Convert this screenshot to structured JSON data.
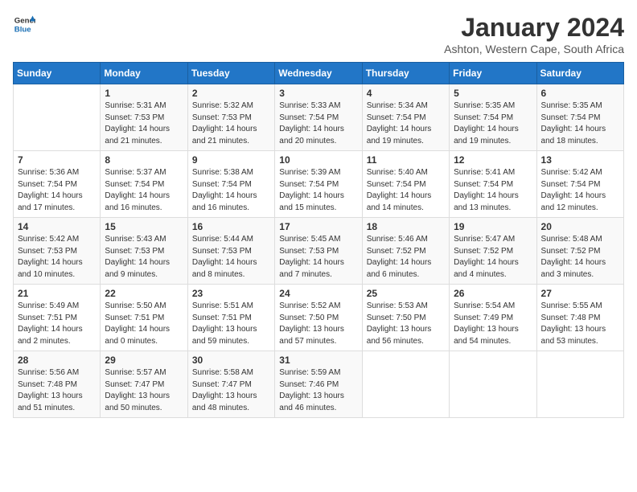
{
  "logo": {
    "line1": "General",
    "line2": "Blue"
  },
  "calendar": {
    "title": "January 2024",
    "subtitle": "Ashton, Western Cape, South Africa",
    "days_of_week": [
      "Sunday",
      "Monday",
      "Tuesday",
      "Wednesday",
      "Thursday",
      "Friday",
      "Saturday"
    ],
    "weeks": [
      [
        {
          "day": "",
          "info": ""
        },
        {
          "day": "1",
          "info": "Sunrise: 5:31 AM\nSunset: 7:53 PM\nDaylight: 14 hours\nand 21 minutes."
        },
        {
          "day": "2",
          "info": "Sunrise: 5:32 AM\nSunset: 7:53 PM\nDaylight: 14 hours\nand 21 minutes."
        },
        {
          "day": "3",
          "info": "Sunrise: 5:33 AM\nSunset: 7:54 PM\nDaylight: 14 hours\nand 20 minutes."
        },
        {
          "day": "4",
          "info": "Sunrise: 5:34 AM\nSunset: 7:54 PM\nDaylight: 14 hours\nand 19 minutes."
        },
        {
          "day": "5",
          "info": "Sunrise: 5:35 AM\nSunset: 7:54 PM\nDaylight: 14 hours\nand 19 minutes."
        },
        {
          "day": "6",
          "info": "Sunrise: 5:35 AM\nSunset: 7:54 PM\nDaylight: 14 hours\nand 18 minutes."
        }
      ],
      [
        {
          "day": "7",
          "info": "Sunrise: 5:36 AM\nSunset: 7:54 PM\nDaylight: 14 hours\nand 17 minutes."
        },
        {
          "day": "8",
          "info": "Sunrise: 5:37 AM\nSunset: 7:54 PM\nDaylight: 14 hours\nand 16 minutes."
        },
        {
          "day": "9",
          "info": "Sunrise: 5:38 AM\nSunset: 7:54 PM\nDaylight: 14 hours\nand 16 minutes."
        },
        {
          "day": "10",
          "info": "Sunrise: 5:39 AM\nSunset: 7:54 PM\nDaylight: 14 hours\nand 15 minutes."
        },
        {
          "day": "11",
          "info": "Sunrise: 5:40 AM\nSunset: 7:54 PM\nDaylight: 14 hours\nand 14 minutes."
        },
        {
          "day": "12",
          "info": "Sunrise: 5:41 AM\nSunset: 7:54 PM\nDaylight: 14 hours\nand 13 minutes."
        },
        {
          "day": "13",
          "info": "Sunrise: 5:42 AM\nSunset: 7:54 PM\nDaylight: 14 hours\nand 12 minutes."
        }
      ],
      [
        {
          "day": "14",
          "info": "Sunrise: 5:42 AM\nSunset: 7:53 PM\nDaylight: 14 hours\nand 10 minutes."
        },
        {
          "day": "15",
          "info": "Sunrise: 5:43 AM\nSunset: 7:53 PM\nDaylight: 14 hours\nand 9 minutes."
        },
        {
          "day": "16",
          "info": "Sunrise: 5:44 AM\nSunset: 7:53 PM\nDaylight: 14 hours\nand 8 minutes."
        },
        {
          "day": "17",
          "info": "Sunrise: 5:45 AM\nSunset: 7:53 PM\nDaylight: 14 hours\nand 7 minutes."
        },
        {
          "day": "18",
          "info": "Sunrise: 5:46 AM\nSunset: 7:52 PM\nDaylight: 14 hours\nand 6 minutes."
        },
        {
          "day": "19",
          "info": "Sunrise: 5:47 AM\nSunset: 7:52 PM\nDaylight: 14 hours\nand 4 minutes."
        },
        {
          "day": "20",
          "info": "Sunrise: 5:48 AM\nSunset: 7:52 PM\nDaylight: 14 hours\nand 3 minutes."
        }
      ],
      [
        {
          "day": "21",
          "info": "Sunrise: 5:49 AM\nSunset: 7:51 PM\nDaylight: 14 hours\nand 2 minutes."
        },
        {
          "day": "22",
          "info": "Sunrise: 5:50 AM\nSunset: 7:51 PM\nDaylight: 14 hours\nand 0 minutes."
        },
        {
          "day": "23",
          "info": "Sunrise: 5:51 AM\nSunset: 7:51 PM\nDaylight: 13 hours\nand 59 minutes."
        },
        {
          "day": "24",
          "info": "Sunrise: 5:52 AM\nSunset: 7:50 PM\nDaylight: 13 hours\nand 57 minutes."
        },
        {
          "day": "25",
          "info": "Sunrise: 5:53 AM\nSunset: 7:50 PM\nDaylight: 13 hours\nand 56 minutes."
        },
        {
          "day": "26",
          "info": "Sunrise: 5:54 AM\nSunset: 7:49 PM\nDaylight: 13 hours\nand 54 minutes."
        },
        {
          "day": "27",
          "info": "Sunrise: 5:55 AM\nSunset: 7:48 PM\nDaylight: 13 hours\nand 53 minutes."
        }
      ],
      [
        {
          "day": "28",
          "info": "Sunrise: 5:56 AM\nSunset: 7:48 PM\nDaylight: 13 hours\nand 51 minutes."
        },
        {
          "day": "29",
          "info": "Sunrise: 5:57 AM\nSunset: 7:47 PM\nDaylight: 13 hours\nand 50 minutes."
        },
        {
          "day": "30",
          "info": "Sunrise: 5:58 AM\nSunset: 7:47 PM\nDaylight: 13 hours\nand 48 minutes."
        },
        {
          "day": "31",
          "info": "Sunrise: 5:59 AM\nSunset: 7:46 PM\nDaylight: 13 hours\nand 46 minutes."
        },
        {
          "day": "",
          "info": ""
        },
        {
          "day": "",
          "info": ""
        },
        {
          "day": "",
          "info": ""
        }
      ]
    ]
  }
}
